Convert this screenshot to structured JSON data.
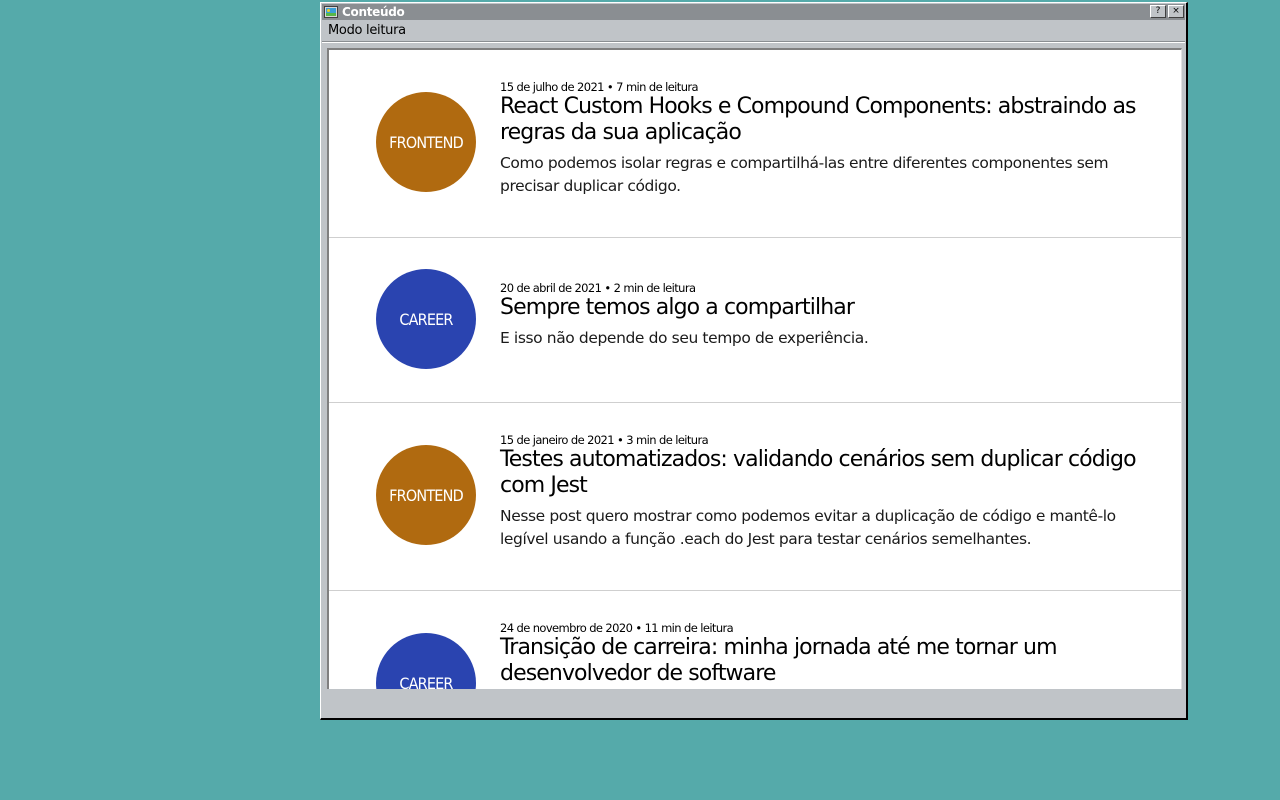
{
  "window": {
    "title": "Conteúdo",
    "help_button": "?",
    "close_button": "×"
  },
  "menu": {
    "items": [
      {
        "label": "Modo leitura"
      }
    ]
  },
  "colors": {
    "desktop": "#55aaaa",
    "frontend": "#b06a10",
    "career": "#2a44b0"
  },
  "posts": [
    {
      "tag": "FRONTEND",
      "tag_color": "frontend",
      "meta": "15 de julho de 2021 • 7 min de leitura",
      "title": "React Custom Hooks e Compound Components: abstraindo as regras da sua aplicação",
      "description": "Como podemos isolar regras e compartilhá-las entre diferentes componentes sem precisar duplicar código."
    },
    {
      "tag": "CAREER",
      "tag_color": "career",
      "meta": "20 de abril de 2021 • 2 min de leitura",
      "title": "Sempre temos algo a compartilhar",
      "description": "E isso não depende do seu tempo de experiência."
    },
    {
      "tag": "FRONTEND",
      "tag_color": "frontend",
      "meta": "15 de janeiro de 2021 • 3 min de leitura",
      "title": "Testes automatizados: validando cenários sem duplicar código com Jest",
      "description": "Nesse post quero mostrar como podemos evitar a duplicação de código e mantê-lo legível usando a função .each do Jest para testar cenários semelhantes."
    },
    {
      "tag": "CAREER",
      "tag_color": "career",
      "meta": "24 de novembro de 2020 • 11 min de leitura",
      "title": "Transição de carreira: minha jornada até me tornar um desenvolvedor de software",
      "description": ""
    }
  ]
}
